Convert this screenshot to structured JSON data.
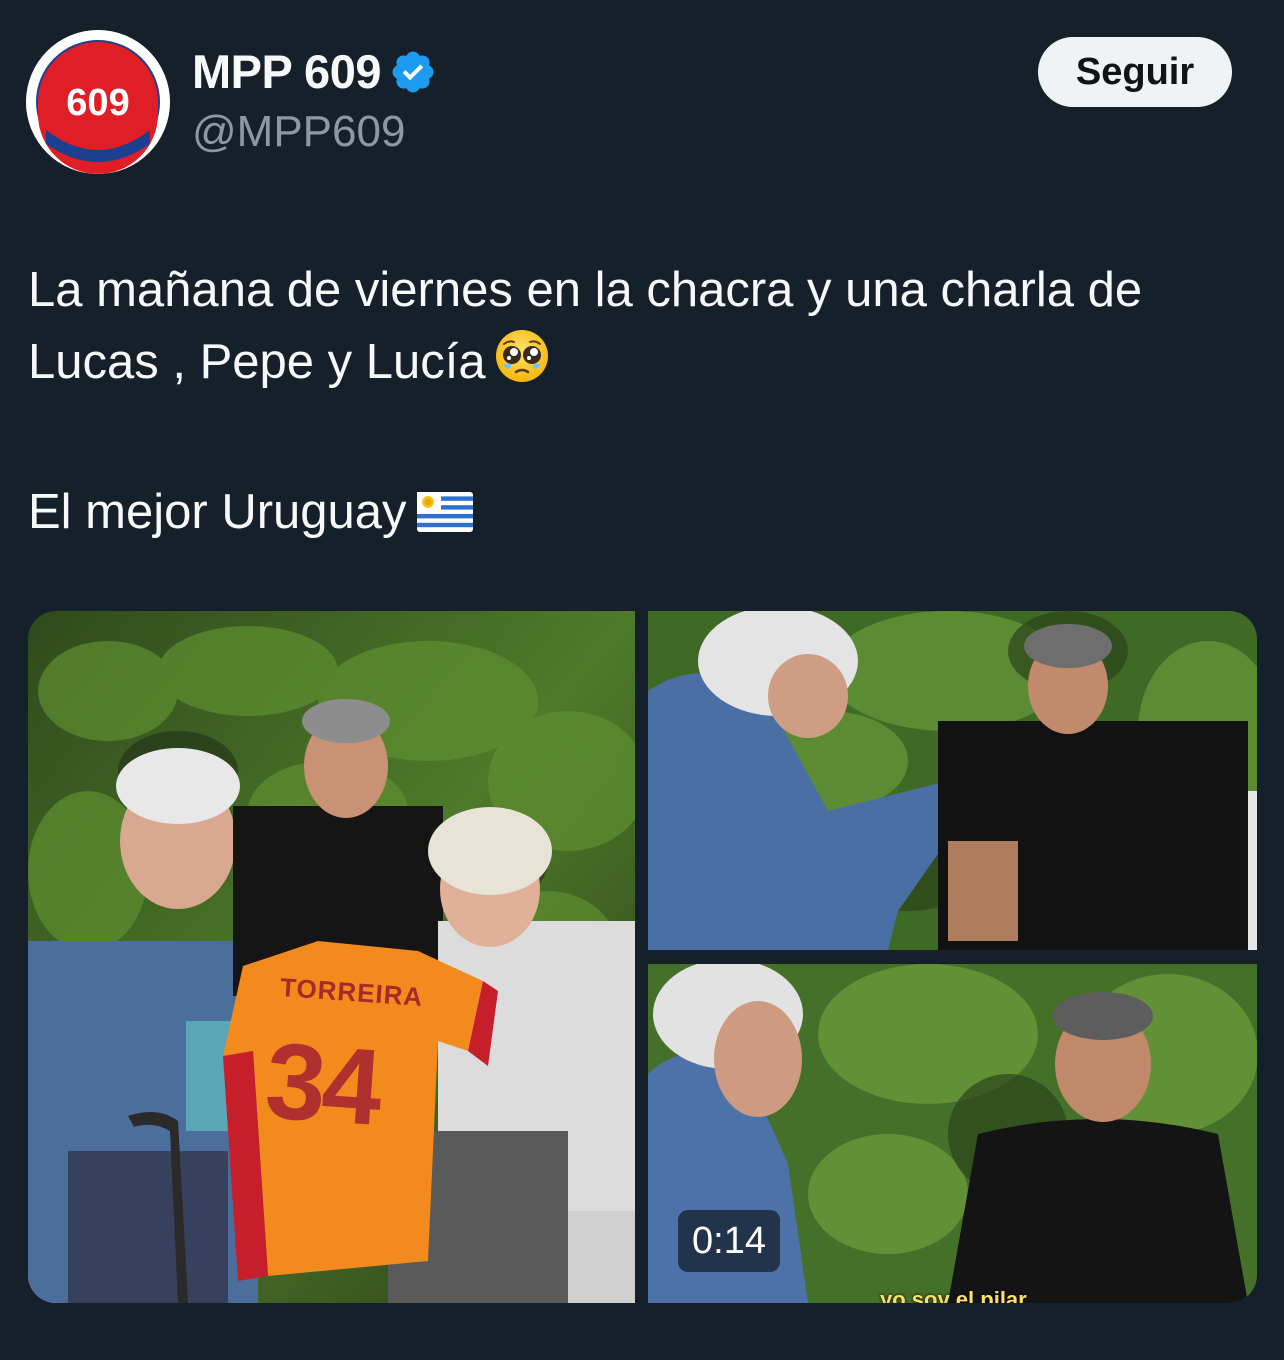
{
  "author": {
    "display_name": "MPP 609",
    "handle": "@MPP609",
    "avatar_text": "609",
    "verified": true
  },
  "follow_button": {
    "label": "Seguir"
  },
  "tweet": {
    "line1": "La mañana de viernes en la chacra y una charla de",
    "line2": "Lucas , Pepe y Lucía",
    "line3": "El mejor Uruguay",
    "emoji_1": "pleading-face-emoji",
    "emoji_2": "uruguay-flag-emoji"
  },
  "media": {
    "jersey_name": "TORREIRA",
    "jersey_number": "34",
    "video_duration": "0:14",
    "video_subtitle": "yo soy el pilar"
  },
  "colors": {
    "background": "#15202b",
    "text_primary": "#f7f9f9",
    "text_secondary": "#8b98a5",
    "verified_blue": "#1d9bf0",
    "button_bg": "#eff3f4"
  }
}
